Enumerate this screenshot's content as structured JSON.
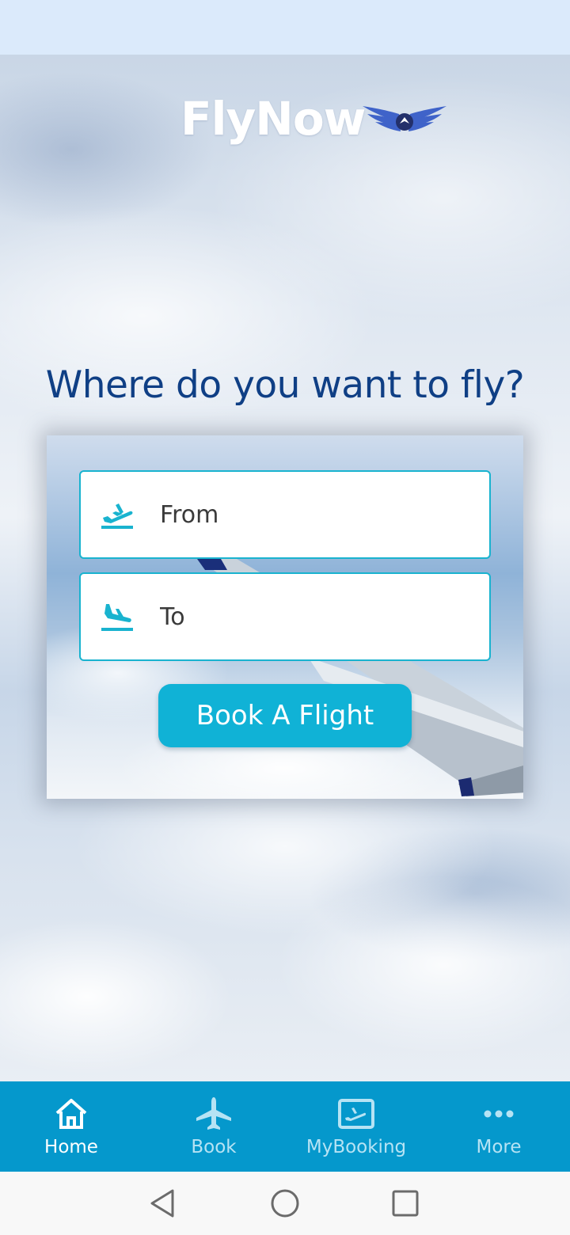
{
  "app": {
    "brand": "FlyNow"
  },
  "main": {
    "headline": "Where do you want to fly?",
    "from_placeholder": "From",
    "to_placeholder": "To",
    "book_button": "Book A Flight"
  },
  "nav": {
    "items": [
      {
        "label": "Home",
        "icon": "home-icon",
        "active": true
      },
      {
        "label": "Book",
        "icon": "airplane-icon",
        "active": false
      },
      {
        "label": "MyBooking",
        "icon": "ticket-icon",
        "active": false
      },
      {
        "label": "More",
        "icon": "more-dots-icon",
        "active": false
      }
    ]
  },
  "colors": {
    "accent": "#10b2d6",
    "nav_bg": "#0598cc",
    "headline": "#0f3f85",
    "status_bar": "#dbeafb"
  }
}
